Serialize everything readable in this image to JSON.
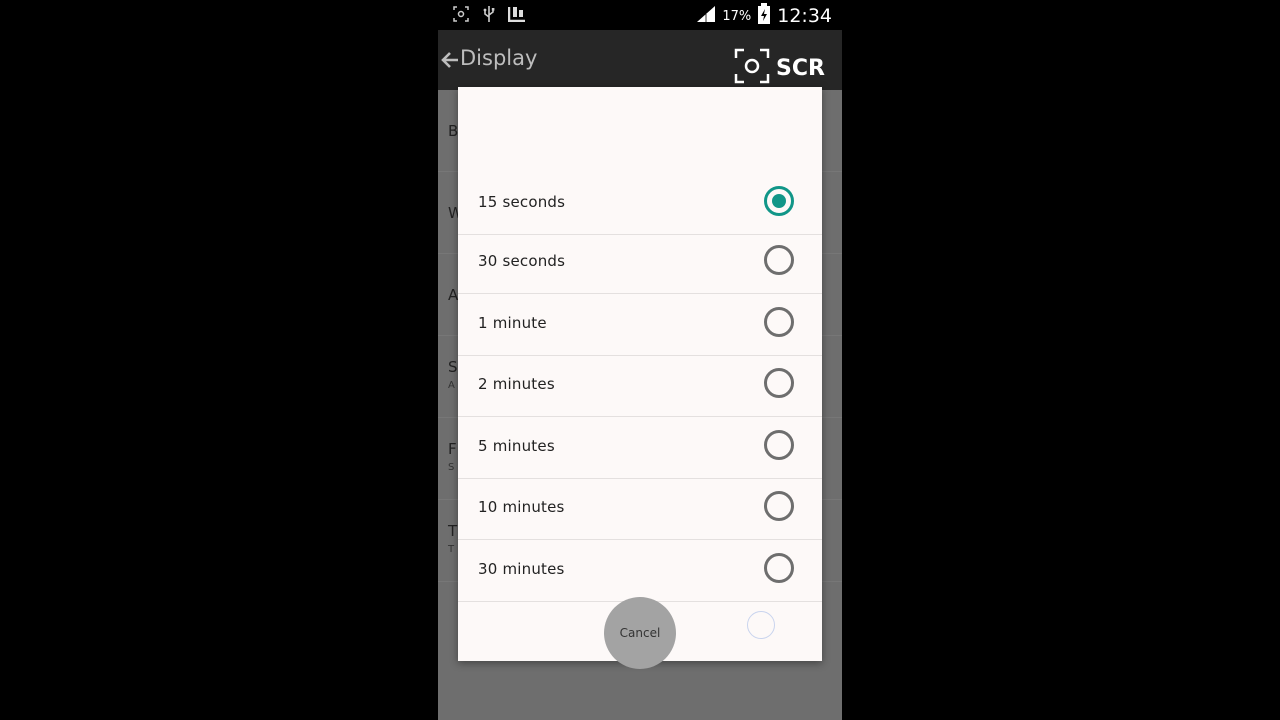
{
  "status_bar": {
    "icons": [
      "screenshot-icon",
      "usb-icon",
      "app-notification-icon",
      "signal-icon",
      "battery-charging-icon"
    ],
    "battery_percent": "17%",
    "time": "12:34"
  },
  "app_bar": {
    "title": "Display",
    "badge_text": "SCR"
  },
  "background_list": {
    "items": [
      {
        "letter": "B",
        "sub": ""
      },
      {
        "letter": "W",
        "sub": ""
      },
      {
        "letter": "A",
        "sub": ""
      },
      {
        "letter": "S",
        "sub": "A"
      },
      {
        "letter": "F",
        "sub": "S"
      },
      {
        "letter": "T",
        "sub": "T"
      }
    ]
  },
  "dialog": {
    "options": [
      {
        "label": "15 seconds",
        "checked": true
      },
      {
        "label": "30 seconds",
        "checked": false
      },
      {
        "label": "1 minute",
        "checked": false
      },
      {
        "label": "2 minutes",
        "checked": false
      },
      {
        "label": "5 minutes",
        "checked": false
      },
      {
        "label": "10 minutes",
        "checked": false
      },
      {
        "label": "30 minutes",
        "checked": false
      }
    ],
    "cancel_label": "Cancel"
  },
  "colors": {
    "accent": "#119688",
    "appbar": "#262626",
    "dialog_bg": "#fdf9f8"
  }
}
